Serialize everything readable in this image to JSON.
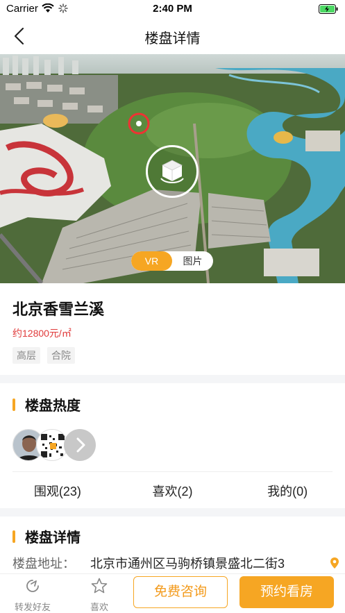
{
  "status_bar": {
    "carrier": "Carrier",
    "time": "2:40 PM"
  },
  "nav": {
    "title": "楼盘详情"
  },
  "hero": {
    "tabs": [
      {
        "label": "VR"
      },
      {
        "label": "图片"
      }
    ]
  },
  "property": {
    "name": "北京香雪兰溪",
    "price": "约12800元/㎡",
    "tags": [
      "高层",
      "合院"
    ]
  },
  "heat": {
    "title": "楼盘热度",
    "stats": [
      "围观(23)",
      "喜欢(2)",
      "我的(0)"
    ]
  },
  "details": {
    "title": "楼盘详情",
    "address_label": "楼盘地址：",
    "address_value": "北京市通州区马驹桥镇景盛北二街3"
  },
  "bottom_bar": {
    "share_label": "转发好友",
    "like_label": "喜欢",
    "consult_label": "免费咨询",
    "book_label": "预约看房"
  },
  "colors": {
    "accent": "#f6a623",
    "price": "#e03a3a"
  }
}
